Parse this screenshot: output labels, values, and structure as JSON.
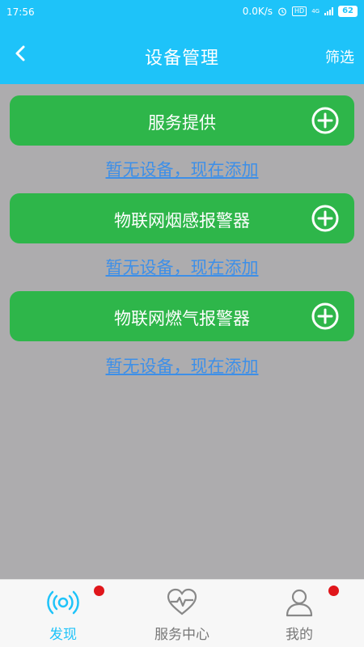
{
  "status_bar": {
    "time": "17:56",
    "speed": "0.0K/s",
    "hd": "HD",
    "network": "4G",
    "battery": "62"
  },
  "header": {
    "title": "设备管理",
    "filter_label": "筛选"
  },
  "sections": [
    {
      "title": "服务提供",
      "empty_text": "暂无设备，现在添加"
    },
    {
      "title": "物联网烟感报警器",
      "empty_text": "暂无设备，现在添加"
    },
    {
      "title": "物联网燃气报警器",
      "empty_text": "暂无设备，现在添加"
    }
  ],
  "bottom_nav": {
    "items": [
      {
        "label": "发现",
        "icon": "broadcast-icon",
        "active": true,
        "badge": true
      },
      {
        "label": "服务中心",
        "icon": "heart-pulse-icon",
        "active": false,
        "badge": false
      },
      {
        "label": "我的",
        "icon": "user-icon",
        "active": false,
        "badge": true
      }
    ]
  },
  "colors": {
    "header": "#1ec3f9",
    "background": "#adacae",
    "card": "#2eb64a",
    "link": "#3d8fe8",
    "badge": "#e0161b"
  }
}
